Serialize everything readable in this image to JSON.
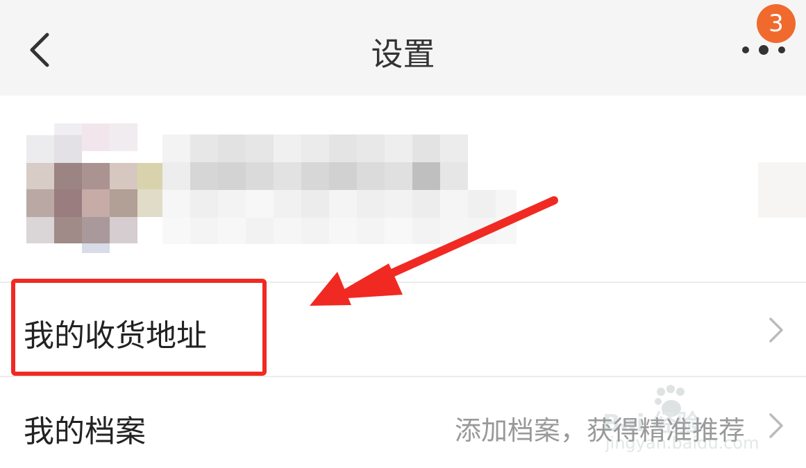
{
  "header": {
    "title": "设置",
    "notification_count": "3",
    "back_icon": "chevron-left-icon",
    "more_icon": "more-dots-icon"
  },
  "menu": {
    "items": [
      {
        "label": "我的收货地址",
        "hint": ""
      },
      {
        "label": "我的档案",
        "hint": "添加档案，获得精准推荐"
      }
    ]
  },
  "watermark": {
    "brand": "Bai 经验",
    "url": "jingyan.baidu.com"
  },
  "colors": {
    "header_bg": "#f5f5f5",
    "badge": "#f06a2e",
    "annotation": "#f02a22"
  }
}
